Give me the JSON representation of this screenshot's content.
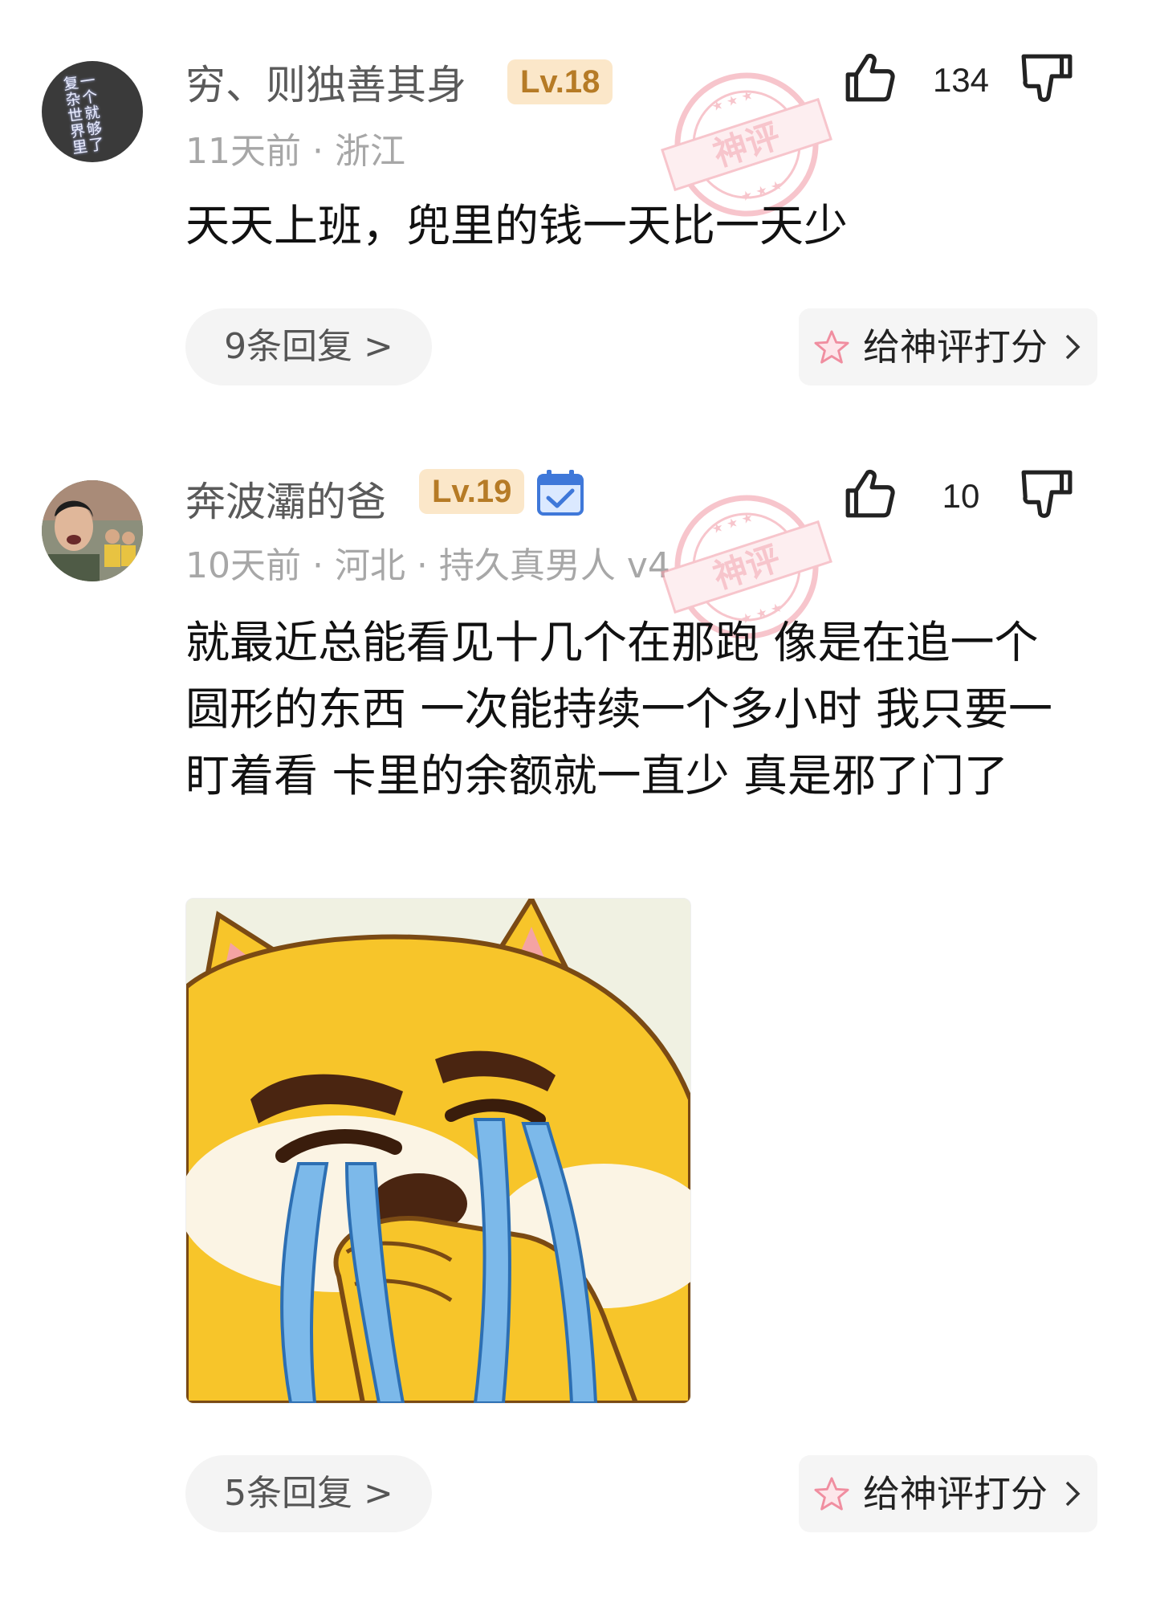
{
  "comments": [
    {
      "avatar_text": "一个就够了复杂世界里",
      "username": "穷、则独善其身",
      "level": "Lv.18",
      "meta": "11天前 · 浙江",
      "likes": "134",
      "text": "天天上班，兜里的钱一天比一天少",
      "replies": "9条回复 >",
      "rate_label": "给神评打分",
      "stamp_text": "神评",
      "icons": [
        "thumb-up-icon",
        "thumb-down-icon",
        "star-icon",
        "chevron-right-icon"
      ]
    },
    {
      "username": "奔波灞的爸",
      "level": "Lv.19",
      "meta": "10天前 · 河北 · 持久真男人 v4",
      "likes": "10",
      "text": "就最近总能看见十几个在那跑 像是在追一个圆形的东西 一次能持续一个多小时 我只要一盯着看 卡里的余额就一直少 真是邪了门了",
      "replies": "5条回复 >",
      "rate_label": "给神评打分",
      "stamp_text": "神评",
      "icons": [
        "calendar-check-icon",
        "thumb-up-icon",
        "thumb-down-icon",
        "star-icon",
        "chevron-right-icon"
      ]
    }
  ],
  "colors": {
    "level_bg": "#fbe7c9",
    "level_text": "#b67b26",
    "stamp": "#f2a0ab",
    "meta_text": "#a7a7a7",
    "star": "#f08ea0"
  }
}
